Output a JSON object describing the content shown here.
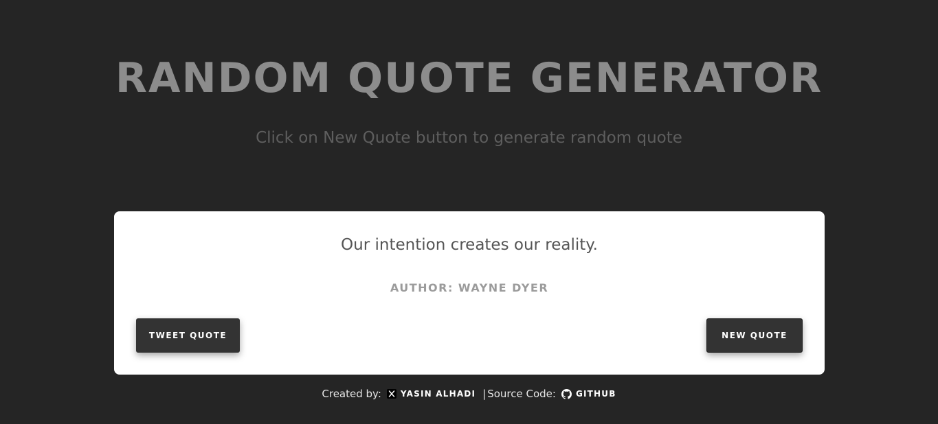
{
  "header": {
    "title": "RANDOM QUOTE GENERATOR",
    "subtitle": "Click on New Quote button to generate random quote"
  },
  "quote": {
    "text": "Our intention creates our reality.",
    "author": "AUTHOR: WAYNE DYER"
  },
  "buttons": {
    "tweet_label": "TWEET QUOTE",
    "new_label": "NEW QUOTE"
  },
  "footer": {
    "created_by_label": "Created by:",
    "author_link": "YASIN ALHADI",
    "author_icon": "x-twitter-icon",
    "separator": "|",
    "source_label": "Source Code:",
    "source_link": "GITHUB",
    "source_icon": "github-icon"
  },
  "colors": {
    "background": "#252525",
    "title": "#8c8c8c",
    "card": "#ffffff",
    "button": "#333333"
  }
}
